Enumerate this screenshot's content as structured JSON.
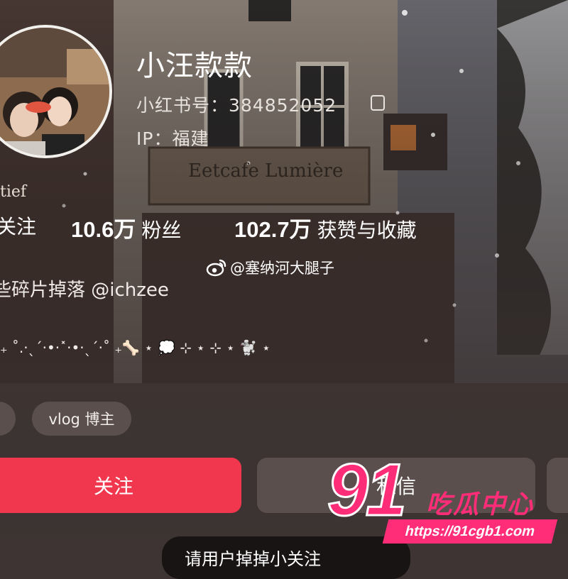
{
  "profile": {
    "name": "小汪款款",
    "red_id": "小红书号：384852052",
    "ip": "IP：福建",
    "sign_text": "Eetcafe Lumière",
    "sign_left": "tief"
  },
  "stats": {
    "following_label": "关注",
    "fans_count": "10.6万",
    "fans_label": "粉丝",
    "likes_count": "102.7万",
    "likes_label": "获赞与收藏"
  },
  "weibo": {
    "handle": "@塞纳河大腿子",
    "icon": "weibo-icon"
  },
  "bio": {
    "line1": "些碎片掉落 @ichzee",
    "decor": "₊ ˚.·ˎˊ·•·˟·•·ˎˊ·˚ ₊🦴 ⋆ 💭 ⊹ ⋆ ⊹ ⋆ 🐩 ⋆"
  },
  "tags": [
    {
      "label": ""
    },
    {
      "label": "vlog 博主"
    }
  ],
  "actions": {
    "follow": "关注",
    "message": "私信"
  },
  "bottom_tip": "请用户掉掉小关注",
  "watermark": {
    "logo": "91吃瓜中心",
    "url": "https://91cgb1.com"
  },
  "colors": {
    "accent": "#f0374d",
    "watermark_pink": "#ff2d78"
  }
}
